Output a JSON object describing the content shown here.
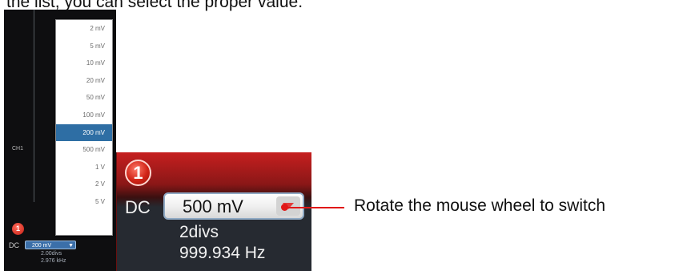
{
  "top_caption": "the list, you can select the proper value.",
  "left_panel": {
    "dropdown": {
      "options": [
        "2 mV",
        "5 mV",
        "10 mV",
        "20 mV",
        "50 mV",
        "100 mV",
        "200 mV",
        "500 mV",
        "1 V",
        "2 V",
        "5 V"
      ],
      "selected": "200 mV"
    },
    "channel_side_label": "CH1",
    "channel_number": "1",
    "coupling": "DC",
    "selected_value": "200 mV",
    "divs": "2.00divs",
    "frequency": "2.976 kHz"
  },
  "zoom_panel": {
    "channel_number": "1",
    "coupling": "DC",
    "volts_per_div": "500 mV",
    "divs": "2divs",
    "frequency": "999.934 Hz"
  },
  "annotation": "Rotate the mouse wheel to switch",
  "colors": {
    "accent_red": "#e01818",
    "selection_blue": "#2e6ea4"
  }
}
